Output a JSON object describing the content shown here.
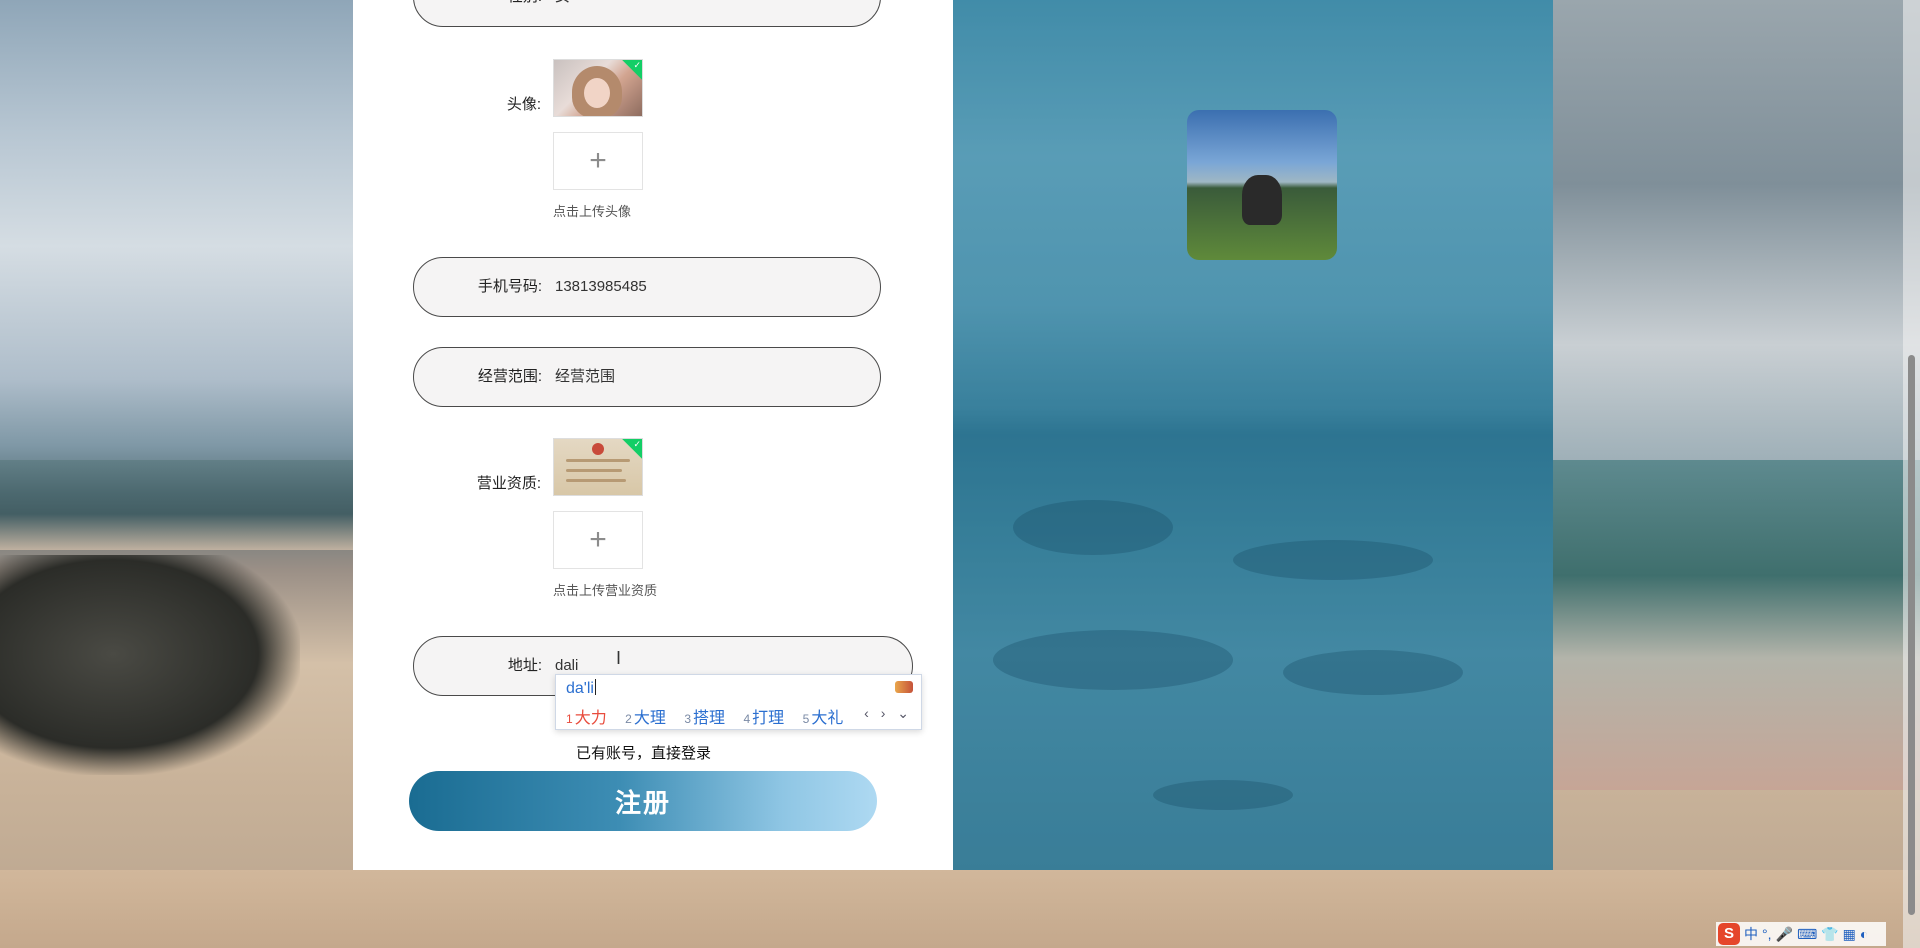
{
  "form": {
    "gender": {
      "label": "性别:",
      "value": "女"
    },
    "avatar": {
      "label": "头像:",
      "hint": "点击上传头像",
      "add_symbol": "+"
    },
    "phone": {
      "label": "手机号码:",
      "value": "13813985485"
    },
    "business_scope": {
      "label": "经营范围:",
      "placeholder": "经营范围"
    },
    "license": {
      "label": "营业资质:",
      "hint": "点击上传营业资质",
      "add_symbol": "+"
    },
    "address": {
      "label": "地址:",
      "value": "dali"
    },
    "login_link": "已有账号，直接登录",
    "register_button": "注册"
  },
  "ime": {
    "composition": "da'li",
    "candidates": [
      {
        "num": "1",
        "text": "大力"
      },
      {
        "num": "2",
        "text": "大理"
      },
      {
        "num": "3",
        "text": "搭理"
      },
      {
        "num": "4",
        "text": "打理"
      },
      {
        "num": "5",
        "text": "大礼"
      }
    ],
    "nav": "‹ › ⌄"
  },
  "tray": {
    "logo": "S",
    "mode": "中",
    "punct": "°,",
    "icons": [
      "microphone-icon",
      "keyboard-icon",
      "shirt-icon",
      "grid-icon",
      "skin-icon"
    ]
  },
  "colors": {
    "accent_start": "#1a6c92",
    "accent_end": "#aed9f2",
    "upload_ok": "#13ce66",
    "ime_first": "#e84c3d",
    "ime_text": "#2b6fd0"
  }
}
